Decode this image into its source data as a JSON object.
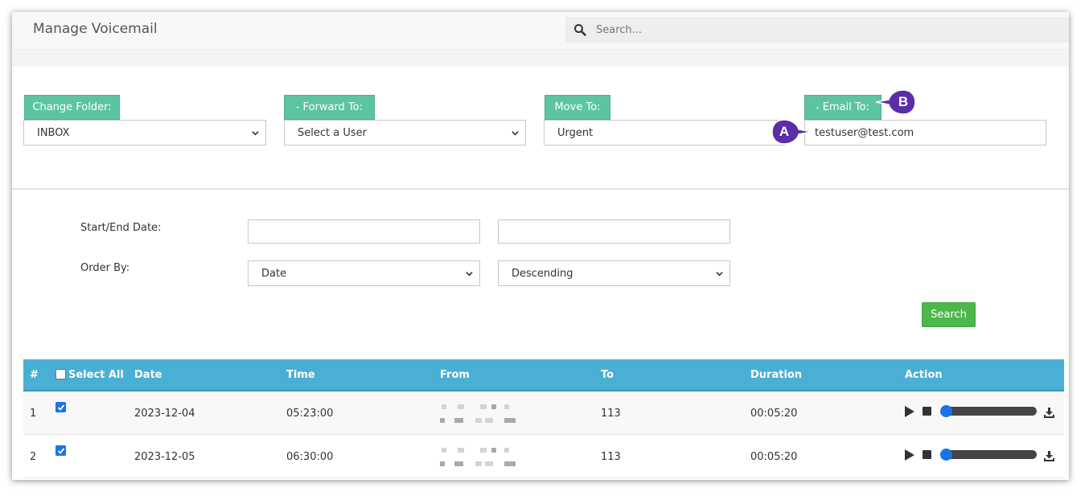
{
  "header": {
    "title": "Manage Voicemail",
    "search_placeholder": "Search..."
  },
  "actions": {
    "change_folder": {
      "label": "Change Folder:",
      "value": "INBOX"
    },
    "forward_to": {
      "label": "Forward To:",
      "value": "Select a User",
      "icon": "share-icon"
    },
    "move_to": {
      "label": "Move To:",
      "value": "Urgent"
    },
    "email_to": {
      "label": "Email To:",
      "value": "testuser@test.com",
      "icon": "upload-icon"
    }
  },
  "filters": {
    "date_label": "Start/End Date:",
    "order_label": "Order By:",
    "order_field": "Date",
    "order_direction": "Descending",
    "search_button": "Search"
  },
  "table": {
    "columns": {
      "num": "#",
      "select_all": "Select All",
      "date": "Date",
      "time": "Time",
      "from": "From",
      "to": "To",
      "duration": "Duration",
      "action": "Action"
    },
    "rows": [
      {
        "num": "1",
        "date": "2023-12-04",
        "time": "05:23:00",
        "to": "113",
        "duration": "00:05:20",
        "checked": true
      },
      {
        "num": "2",
        "date": "2023-12-05",
        "time": "06:30:00",
        "to": "113",
        "duration": "00:05:20",
        "checked": true
      }
    ]
  },
  "callouts": {
    "a": "A",
    "b": "B"
  },
  "colors": {
    "green_button": "#5cc5a0",
    "table_header": "#4aafd4",
    "search_button": "#4cb84c",
    "callout": "#5a2ea6"
  }
}
